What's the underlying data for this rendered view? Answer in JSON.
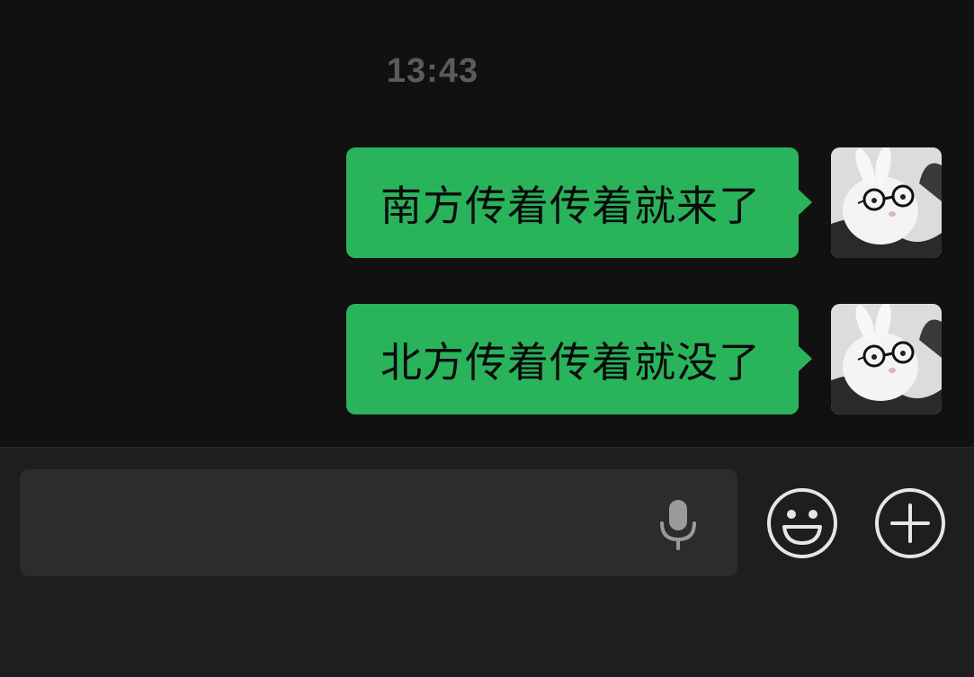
{
  "chat": {
    "timestamp": "13:43",
    "messages": [
      {
        "text": "南方传着传着就来了",
        "sender": "self"
      },
      {
        "text": "北方传着传着就没了",
        "sender": "self"
      }
    ]
  },
  "composer": {
    "value": "",
    "placeholder": ""
  },
  "icons": {
    "mic": "microphone-icon",
    "emoji": "smiley-face-icon",
    "plus": "plus-circle-icon"
  },
  "colors": {
    "background": "#111111",
    "bubble": "#29b35b",
    "input_bar": "#1e1e1e",
    "input_field": "#2c2c2c",
    "timestamp": "#5b5b5b",
    "icon": "#e6e6e6"
  }
}
